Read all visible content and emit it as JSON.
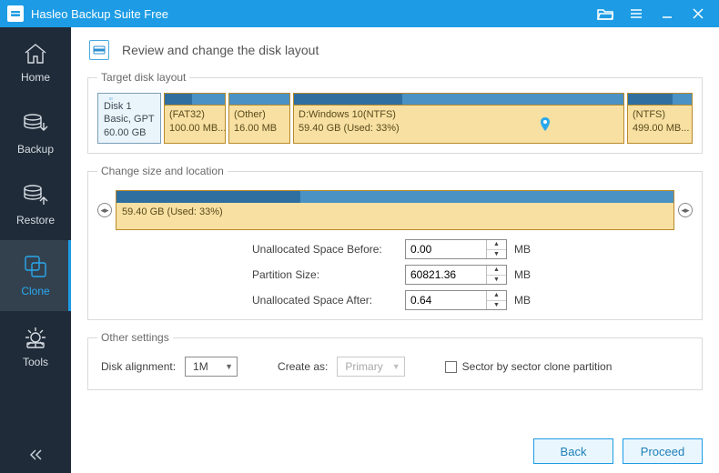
{
  "app": {
    "title": "Hasleo Backup Suite Free"
  },
  "sidebar": {
    "items": [
      {
        "label": "Home"
      },
      {
        "label": "Backup"
      },
      {
        "label": "Restore"
      },
      {
        "label": "Clone"
      },
      {
        "label": "Tools"
      }
    ]
  },
  "page": {
    "title": "Review and change the disk layout"
  },
  "target": {
    "legend": "Target disk layout",
    "disk": {
      "name": "Disk 1",
      "type": "Basic, GPT",
      "size": "60.00 GB"
    },
    "parts": [
      {
        "fs": "(FAT32)",
        "size": "100.00 MB...",
        "used_pct": 45
      },
      {
        "fs": "(Other)",
        "size": "16.00 MB",
        "used_pct": 0
      },
      {
        "fs": "D:Windows 10(NTFS)",
        "size": "59.40 GB (Used: 33%)",
        "used_pct": 33
      },
      {
        "fs": "(NTFS)",
        "size": "499.00 MB...",
        "used_pct": 70
      }
    ]
  },
  "resize": {
    "legend": "Change size and location",
    "label": "59.40 GB (Used: 33%)",
    "fields": {
      "before_label": "Unallocated Space Before:",
      "before_value": "0.00",
      "size_label": "Partition Size:",
      "size_value": "60821.36",
      "after_label": "Unallocated Space After:",
      "after_value": "0.64",
      "unit": "MB"
    }
  },
  "other": {
    "legend": "Other settings",
    "align_label": "Disk alignment:",
    "align_value": "1M",
    "createas_label": "Create as:",
    "createas_value": "Primary",
    "sector_label": "Sector by sector clone partition"
  },
  "footer": {
    "back": "Back",
    "proceed": "Proceed"
  }
}
